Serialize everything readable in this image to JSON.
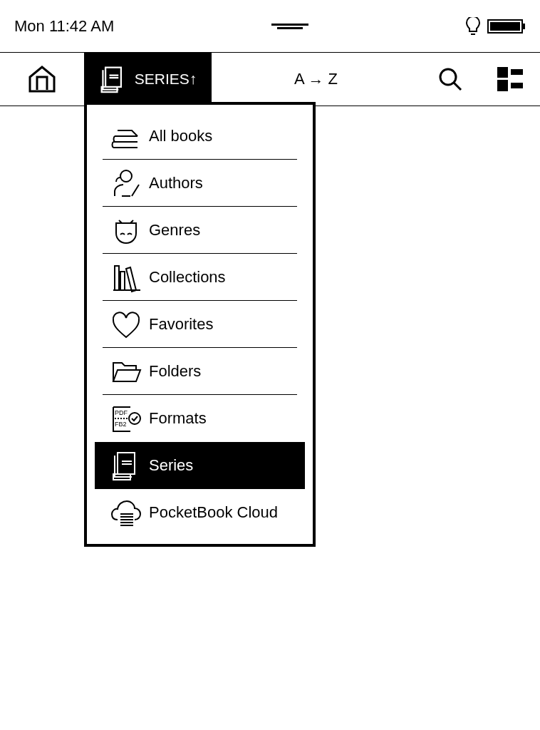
{
  "status_bar": {
    "time": "Mon 11:42 AM"
  },
  "toolbar": {
    "view_tab": {
      "label": "SERIES↑",
      "selected": true
    },
    "sort": "A → Z"
  },
  "menu": {
    "items": [
      {
        "label": "All books",
        "selected": false
      },
      {
        "label": "Authors",
        "selected": false
      },
      {
        "label": "Genres",
        "selected": false
      },
      {
        "label": "Collections",
        "selected": false
      },
      {
        "label": "Favorites",
        "selected": false
      },
      {
        "label": "Folders",
        "selected": false
      },
      {
        "label": "Formats",
        "selected": false,
        "icon_labels": [
          "PDF",
          "FB2"
        ]
      },
      {
        "label": "Series",
        "selected": true
      },
      {
        "label": "PocketBook Cloud",
        "selected": false
      }
    ]
  }
}
